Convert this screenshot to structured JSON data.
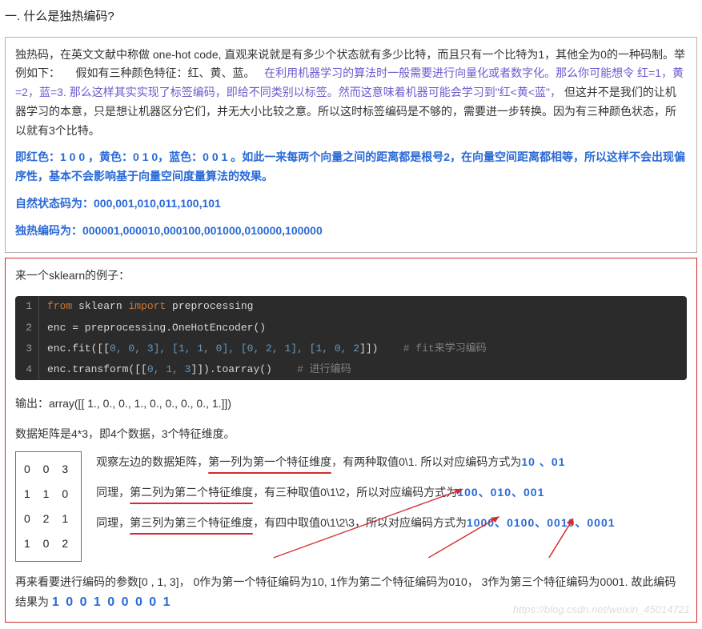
{
  "heading": "一. 什么是独热编码?",
  "box1": {
    "p1a": "独热码，在英文文献中称做 one-hot code, 直观来说就是有多少个状态就有多少比特，而且只有一个比特为1，其他全为0的一种码制。举例如下：",
    "p1b": "假如有三种颜色特征：红、黄、蓝。",
    "p1c": "在利用机器学习的算法时一般需要进行向量化或者数字化。那么你可能想令 红=1，黄=2，蓝=3. 那么这样其实实现了标签编码，即给不同类别以标签。然而这意味着机器可能会学习到\"红<黄<蓝\"，",
    "p1d": "但这并不是我们的让机器学习的本意，只是想让机器区分它们，并无大小比较之意。所以这时标签编码是不够的，需要进一步转换。因为有三种颜色状态，所以就有3个比特。",
    "p2": "即红色：1 0 0 ，黄色：0 1 0，蓝色：0 0 1 。如此一来每两个向量之间的距离都是根号2，在向量空间距离都相等，所以这样不会出现偏序性，基本不会影响基于向量空间度量算法的效果。",
    "p3": "自然状态码为：000,001,010,011,100,101",
    "p4": "独热编码为：000001,000010,000100,001000,010000,100000"
  },
  "box2": {
    "intro": "来一个sklearn的例子：",
    "code": {
      "l1_from": "from",
      "l1_mod": " sklearn ",
      "l1_import": "import",
      "l1_rest": " preprocessing",
      "l2": "enc = preprocessing.OneHotEncoder()",
      "l3a": "enc.fit([[",
      "l3n": "0, 0, 3], [1, 1, 0], [0, 2, 1], [1, 0, 2",
      "l3b": "]])    ",
      "l3c": "# fit来学习编码",
      "l4a": "enc.transform([[",
      "l4n": "0, 1, 3",
      "l4b": "]]).toarray()    ",
      "l4c": "# 进行编码"
    },
    "output": "输出：array([[ 1.,  0.,  0.,  1.,  0.,  0.,  0.,  0.,  1.]])",
    "dims": "数据矩阵是4*3，即4个数据，3个特征维度。",
    "matrix": [
      "0 0 3",
      "1 1 0",
      "0 2 1",
      "1 0 2"
    ],
    "rows": {
      "r1a": "观察左边的数据矩阵，",
      "r1u": "第一列为第一个特征维度",
      "r1b": "，有两种取值0\\1. 所以对应编码方式为",
      "r1enc": "10 、01",
      "r2a": "同理，",
      "r2u": "第二列为第二个特征维度",
      "r2b": "，有三种取值0\\1\\2，所以对应编码方式为",
      "r2enc": "100、010、001",
      "r3a": "同理，",
      "r3u": "第三列为第三个特征维度",
      "r3b": "，有四中取值0\\1\\2\\3，所以对应编码方式为",
      "r3enc": "1000、0100、0010、0001"
    },
    "final_a": "再来看要进行编码的参数[0 , 1,  3]， 0作为第一个特征编码为10,   1作为第二个特征编码为010，  3作为第三个特征编码为0001.  故此编码结果为 ",
    "final_enc": "1 0 0    1 0 0    0 0 1",
    "watermark": "https://blog.csdn.net/weixin_45014721"
  }
}
